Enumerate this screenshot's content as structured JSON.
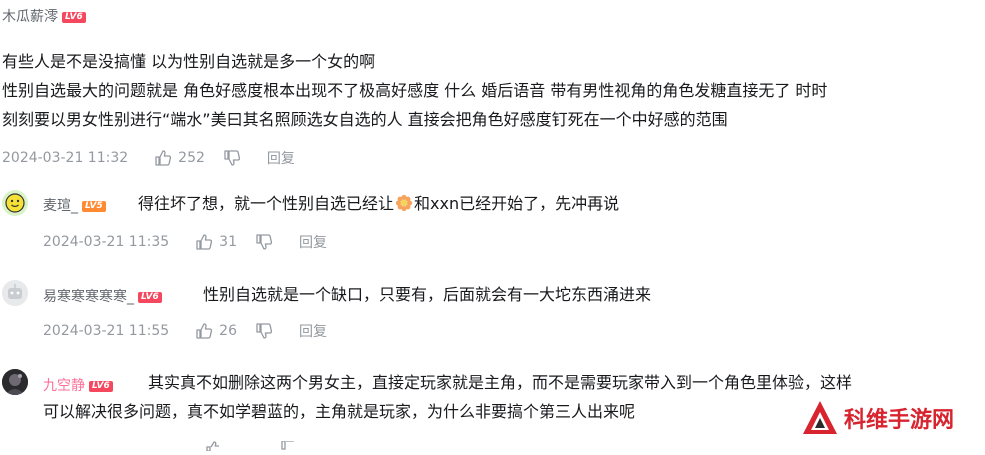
{
  "comments": [
    {
      "user": "木瓜薪澪",
      "level": "LV6",
      "lines": [
        "有些人是不是没搞懂 以为性别自选就是多一个女的啊",
        "性别自选最大的问题就是 角色好感度根本出现不了极高好感度 什么 婚后语音  带有男性视角的角色发糖直接无了 时时",
        "刻刻要以男女性别进行“端水”美曰其名照顾选女自选的人 直接会把角色好感度钉死在一个中好感的范围"
      ],
      "time": "2024-03-21 11:32",
      "likes": "252",
      "reply": "回复"
    },
    {
      "user": "麦瑄_",
      "level": "LV5",
      "text_before": "得往坏了想，就一个性别自选已经让",
      "text_after": "和xxn已经开始了，先冲再说",
      "time": "2024-03-21 11:35",
      "likes": "31",
      "reply": "回复"
    },
    {
      "user": "易寒寒寒寒寒_",
      "level": "LV6",
      "text": "性别自选就是一个缺口，只要有，后面就会有一大坨东西涌进来",
      "time": "2024-03-21 11:55",
      "likes": "26",
      "reply": "回复"
    },
    {
      "user": "九空静",
      "level": "LV6",
      "lines": [
        "其实真不如删除这两个男女主，直接定玩家就是主角，而不是需要玩家带入到一个角色里体验，这样",
        "可以解决很多问题，真不如学碧蓝的，主角就是玩家，为什么非要搞个第三人出来呢"
      ]
    }
  ],
  "watermark": "科维手游网",
  "colors": {
    "level_red": "#f5475d",
    "level_orange": "#ff8a33",
    "meta": "#9499a0",
    "pink_name": "#fb7299"
  },
  "icons": [
    "thumb-up-icon",
    "thumb-down-icon",
    "sunflower-emoji",
    "avatar-yellow-face",
    "avatar-gray-robot",
    "avatar-dark-photo",
    "red-triangle-logo"
  ]
}
